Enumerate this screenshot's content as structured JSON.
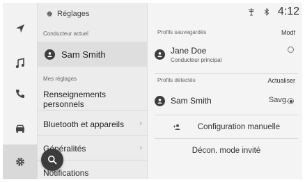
{
  "rail": {
    "items": [
      {
        "icon": "navigation-arrow-icon",
        "active": false
      },
      {
        "icon": "music-note-icon",
        "active": false
      },
      {
        "icon": "phone-icon",
        "active": false
      },
      {
        "icon": "car-icon",
        "active": false
      },
      {
        "icon": "gear-icon",
        "active": true
      }
    ]
  },
  "settings": {
    "title": "Réglages",
    "current_driver_label": "Conducteur actuel",
    "current_driver_name": "Sam Smith",
    "my_settings_label": "Mes réglages",
    "menu": [
      {
        "label": "Renseignements personnels",
        "chevron": ""
      },
      {
        "label": "Bluetooth et appareils",
        "chevron": "›"
      },
      {
        "label": "Généralités",
        "chevron": "›"
      },
      {
        "label": "Notifications",
        "chevron": ""
      }
    ]
  },
  "status": {
    "time": "4:12"
  },
  "profiles": {
    "saved_label": "Profils sauvegardés",
    "saved_action": "Modf",
    "saved": [
      {
        "name": "Jane Doe",
        "subtitle": "Conducteur principal",
        "selected": false
      }
    ],
    "detected_label": "Profils détectés",
    "detected_action": "Actualiser",
    "detected": [
      {
        "name": "Sam Smith",
        "tag": "Savg.",
        "selected": true
      }
    ],
    "manual_config": "Configuration manuelle",
    "guest_logout": "Décon. mode invité"
  },
  "colors": {
    "rail_active": "#d9d9d9",
    "avatar": "#3d3d3d",
    "search_fab": "#3c3c3c"
  }
}
